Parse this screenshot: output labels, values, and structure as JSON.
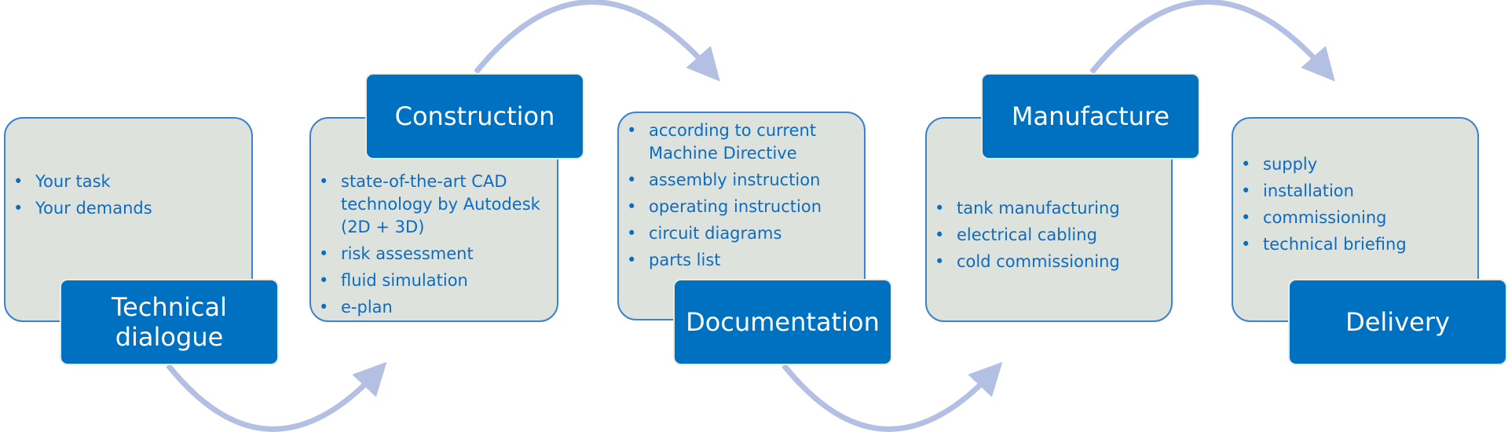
{
  "colors": {
    "box_fill": "#dde3dc",
    "box_border": "#3b82d0",
    "label_fill": "#0070c0",
    "text": "#0a6cc4",
    "arrow": "#b3bfe3"
  },
  "steps": [
    {
      "title": "Technical dialogue",
      "items": [
        "Your task",
        "Your demands"
      ]
    },
    {
      "title": "Construction",
      "items": [
        "state-of-the-art CAD technology by Autodesk (2D + 3D)",
        "risk assessment",
        "fluid simulation",
        "e-plan"
      ]
    },
    {
      "title": "Documentation",
      "items": [
        "according to current Machine Directive",
        "assembly instruction",
        "operating instruction",
        "circuit diagrams",
        "parts list"
      ]
    },
    {
      "title": "Manufacture",
      "items": [
        "tank manufacturing",
        "electrical cabling",
        "cold commissioning"
      ]
    },
    {
      "title": "Delivery",
      "items": [
        "supply",
        "installation",
        "commissioning",
        "technical briefing"
      ]
    }
  ]
}
